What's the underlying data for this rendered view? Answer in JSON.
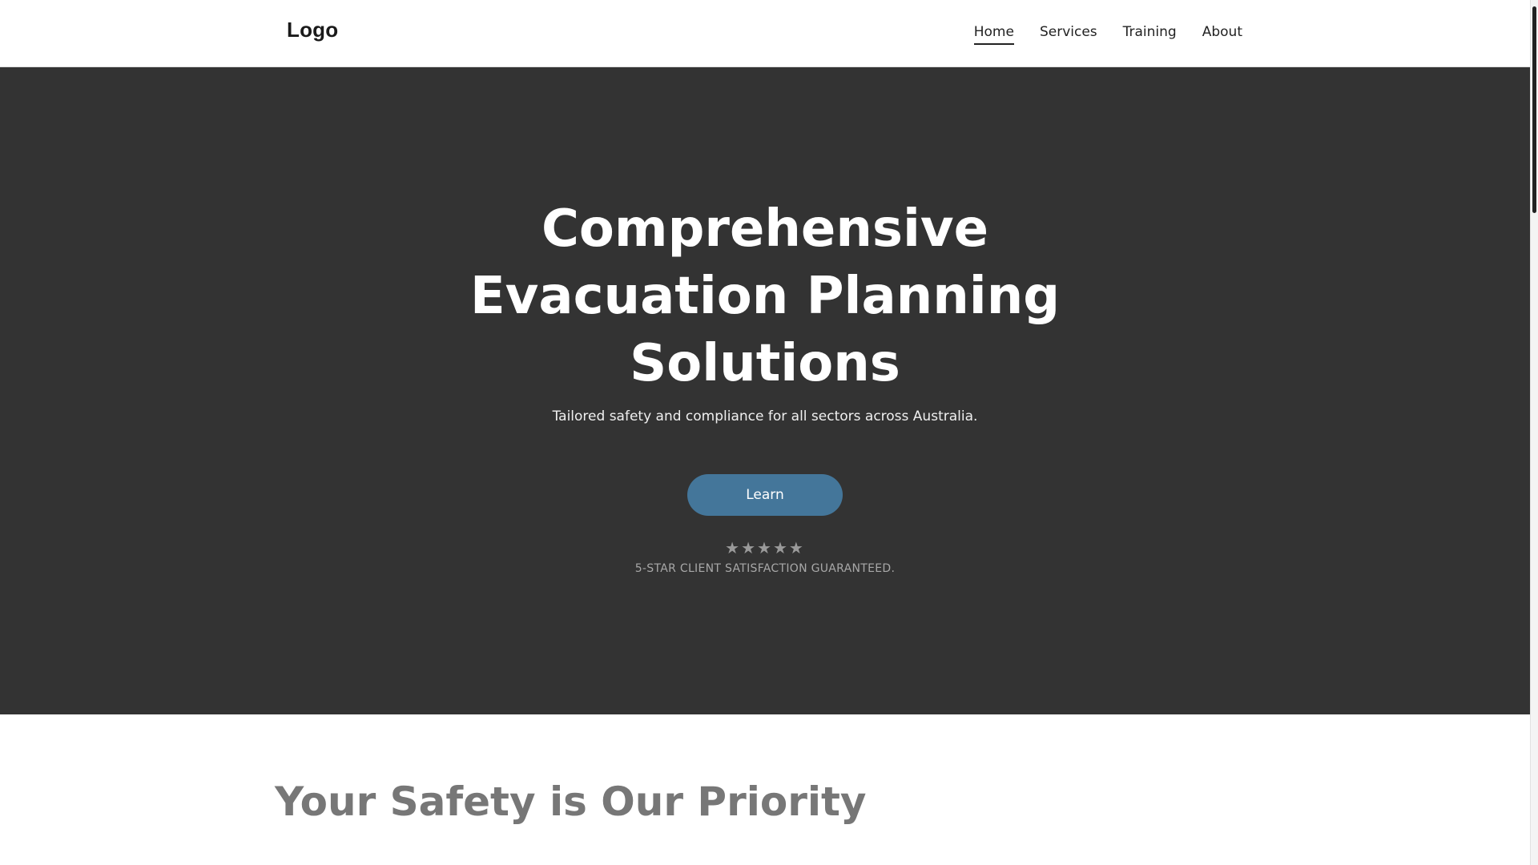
{
  "header": {
    "logo": "Logo",
    "nav": [
      {
        "label": "Home",
        "active": true
      },
      {
        "label": "Services",
        "active": false
      },
      {
        "label": "Training",
        "active": false
      },
      {
        "label": "About",
        "active": false
      }
    ]
  },
  "hero": {
    "title": "Comprehensive Evacuation Planning Solutions",
    "subtitle": "Tailored safety and compliance for all sectors across Australia.",
    "cta_label": "Learn",
    "stars": "★★★★★",
    "rating_value": 5,
    "rating_text": "5-STAR CLIENT SATISFACTION GUARANTEED."
  },
  "section": {
    "title": "Your Safety is Our Priority"
  },
  "colors": {
    "hero_background": "#333333",
    "button_background": "#44769a",
    "section_title": "#777777"
  }
}
